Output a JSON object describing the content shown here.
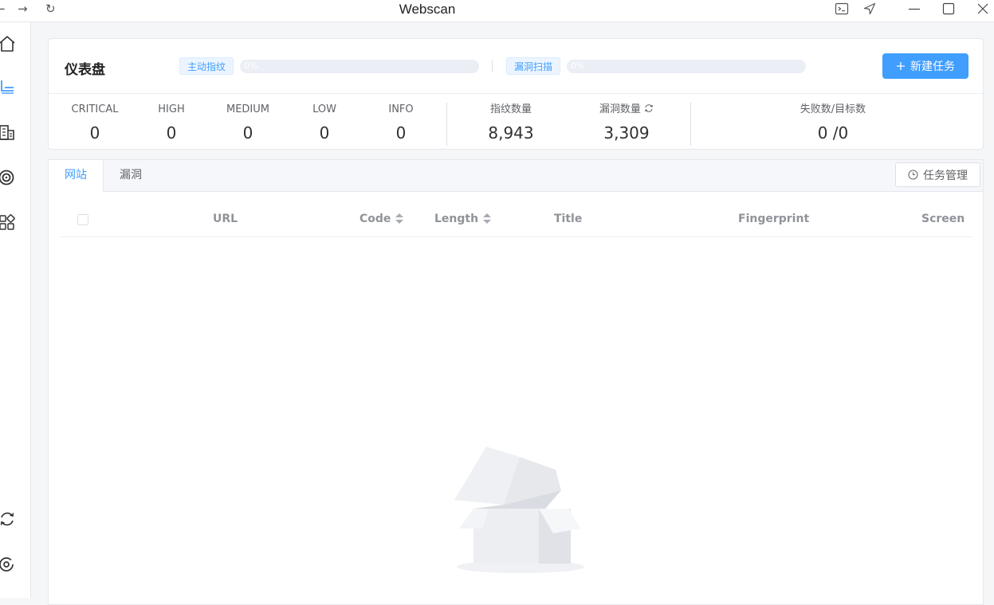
{
  "window": {
    "title": "Webscan",
    "nav_back": "←",
    "nav_forward": "→",
    "nav_reload": "↻"
  },
  "sidebar": {
    "items": [
      {
        "icon": "home-icon"
      },
      {
        "icon": "scan-icon"
      },
      {
        "icon": "building-icon"
      },
      {
        "icon": "target-icon"
      },
      {
        "icon": "apps-icon"
      },
      {
        "icon": "sync-icon"
      },
      {
        "icon": "settings-icon"
      }
    ]
  },
  "dashboard": {
    "title": "仪表盘",
    "fingerprint_tag": "主动指纹",
    "fingerprint_progress": "0%",
    "fingerprint_progress_value": 0,
    "vuln_tag": "漏洞扫描",
    "vuln_progress": "0%",
    "vuln_progress_value": 0,
    "new_task_label": "新建任务",
    "severity": [
      {
        "label": "CRITICAL",
        "value": "0"
      },
      {
        "label": "HIGH",
        "value": "0"
      },
      {
        "label": "MEDIUM",
        "value": "0"
      },
      {
        "label": "LOW",
        "value": "0"
      },
      {
        "label": "INFO",
        "value": "0"
      }
    ],
    "fingerprint_count_label": "指纹数量",
    "fingerprint_count": "8,943",
    "vuln_count_label": "漏洞数量",
    "vuln_count": "3,309",
    "fail_target_label": "失败数/目标数",
    "fail_target_value": "0 /0"
  },
  "tabs": [
    {
      "label": "网站",
      "active": true
    },
    {
      "label": "漏洞",
      "active": false
    }
  ],
  "task_manage_label": "任务管理",
  "table": {
    "columns": [
      "URL",
      "Code",
      "Length",
      "Title",
      "Fingerprint",
      "Screen"
    ]
  },
  "colors": {
    "accent": "#409eff",
    "background": "#f5f6f8"
  }
}
